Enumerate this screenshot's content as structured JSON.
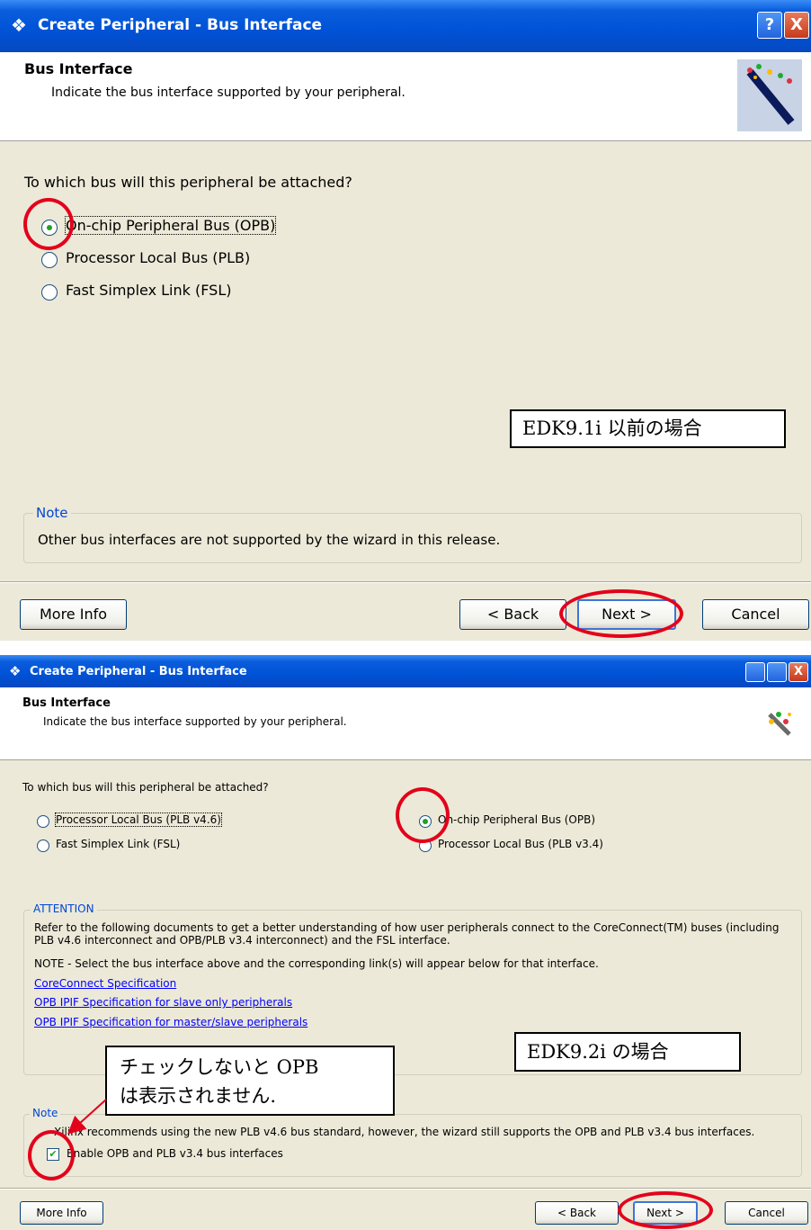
{
  "window_top": {
    "title": "Create Peripheral - Bus Interface",
    "help_btn": "?",
    "close_btn": "X",
    "header": {
      "title": "Bus Interface",
      "subtitle": "Indicate the bus interface supported by your peripheral."
    },
    "question": "To which bus will this peripheral be attached?",
    "options": [
      {
        "label": "On-chip Peripheral Bus (OPB)",
        "selected": true
      },
      {
        "label": "Processor Local Bus (PLB)",
        "selected": false
      },
      {
        "label": "Fast Simplex Link (FSL)",
        "selected": false
      }
    ],
    "callout": "EDK9.1i 以前の場合",
    "note": {
      "legend": "Note",
      "text": "Other bus interfaces are not supported by the wizard in this release."
    },
    "buttons": {
      "more_info": "More Info",
      "back": "< Back",
      "next": "Next >",
      "cancel": "Cancel"
    }
  },
  "window_bottom": {
    "title": "Create Peripheral - Bus Interface",
    "header": {
      "title": "Bus Interface",
      "subtitle": "Indicate the bus interface supported by your peripheral."
    },
    "question": "To which bus will this peripheral be attached?",
    "options_left": [
      {
        "label": "Processor Local Bus (PLB v4.6)",
        "selected": false
      },
      {
        "label": "Fast Simplex Link (FSL)",
        "selected": false
      }
    ],
    "options_right": [
      {
        "label": "On-chip Peripheral Bus (OPB)",
        "selected": true
      },
      {
        "label": "Processor Local Bus (PLB v3.4)",
        "selected": false
      }
    ],
    "attention": {
      "legend": "ATTENTION",
      "line1": "Refer to the following documents to get a better understanding of how user peripherals connect to the CoreConnect(TM) buses (including",
      "line2": "PLB v4.6 interconnect and OPB/PLB v3.4 interconnect) and the FSL interface.",
      "note_line": "NOTE - Select the bus interface above and the corresponding link(s) will appear below for that interface.",
      "links": [
        "CoreConnect Specification",
        "OPB IPIF Specification for slave only peripherals",
        "OPB IPIF Specification for master/slave peripherals"
      ]
    },
    "callout": "EDK9.2i の場合",
    "annotation": {
      "line1": "チェックしないと OPB",
      "line2": "は表示されません."
    },
    "note": {
      "legend": "Note",
      "text": "Xilinx recommends using the new PLB v4.6 bus standard, however, the wizard still supports the OPB and PLB v3.4 bus interfaces.",
      "checkbox_label": "Enable OPB and PLB v3.4 bus interfaces",
      "checked": true
    },
    "buttons": {
      "more_info": "More Info",
      "back": "< Back",
      "next": "Next >",
      "cancel": "Cancel"
    }
  },
  "colors": {
    "titlebar": "#0052d6",
    "dialog_bg": "#ece9d8",
    "annotation_red": "#e3001b",
    "group_label": "#0046d5",
    "link": "#0000ff"
  }
}
